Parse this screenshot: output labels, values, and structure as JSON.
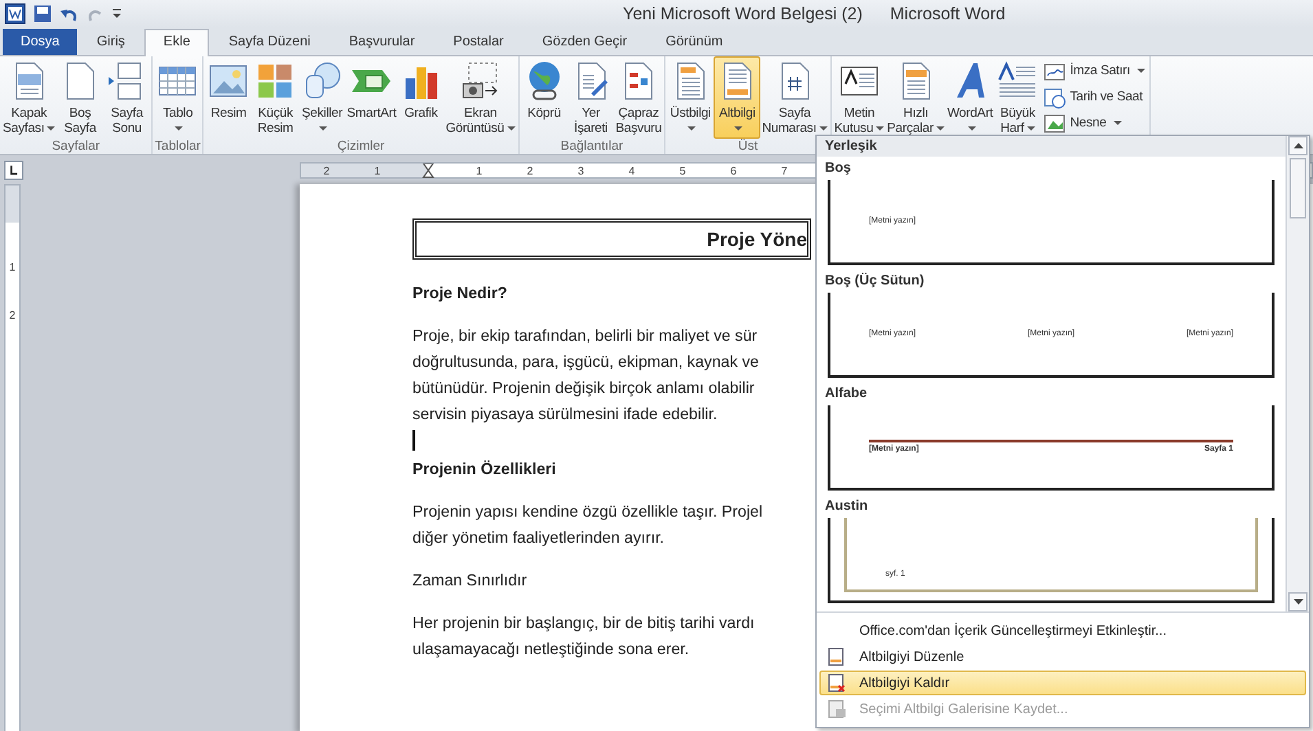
{
  "title_bar": {
    "document": "Yeni Microsoft Word Belgesi (2)",
    "app": "Microsoft Word"
  },
  "tabs": [
    {
      "label": "Dosya",
      "kind": "file",
      "selected": false
    },
    {
      "label": "Giriş",
      "kind": "tab",
      "selected": false
    },
    {
      "label": "Ekle",
      "kind": "tab",
      "selected": true
    },
    {
      "label": "Sayfa Düzeni",
      "kind": "tab",
      "selected": false
    },
    {
      "label": "Başvurular",
      "kind": "tab",
      "selected": false
    },
    {
      "label": "Postalar",
      "kind": "tab",
      "selected": false
    },
    {
      "label": "Gözden Geçir",
      "kind": "tab",
      "selected": false
    },
    {
      "label": "Görünüm",
      "kind": "tab",
      "selected": false
    }
  ],
  "ribbon": {
    "groups": [
      {
        "label": "Sayfalar",
        "buttons": [
          {
            "kind": "large",
            "lines": [
              "Kapak",
              "Sayfası"
            ],
            "dropdown": true,
            "selected": false
          },
          {
            "kind": "large",
            "lines": [
              "Boş",
              "Sayfa"
            ],
            "dropdown": false,
            "selected": false
          },
          {
            "kind": "large",
            "lines": [
              "Sayfa",
              "Sonu"
            ],
            "dropdown": false,
            "selected": false
          }
        ]
      },
      {
        "label": "Tablolar",
        "buttons": [
          {
            "kind": "large",
            "lines": [
              "Tablo"
            ],
            "dropdown": true,
            "selected": false
          }
        ]
      },
      {
        "label": "Çizimler",
        "buttons": [
          {
            "kind": "large",
            "lines": [
              "Resim"
            ],
            "dropdown": false,
            "selected": false
          },
          {
            "kind": "large",
            "lines": [
              "Küçük",
              "Resim"
            ],
            "dropdown": false,
            "selected": false
          },
          {
            "kind": "large",
            "lines": [
              "Şekiller"
            ],
            "dropdown": true,
            "selected": false
          },
          {
            "kind": "large",
            "lines": [
              "SmartArt"
            ],
            "dropdown": false,
            "selected": false
          },
          {
            "kind": "large",
            "lines": [
              "Grafik"
            ],
            "dropdown": false,
            "selected": false
          },
          {
            "kind": "large",
            "lines": [
              "Ekran",
              "Görüntüsü"
            ],
            "dropdown": true,
            "selected": false
          }
        ]
      },
      {
        "label": "Bağlantılar",
        "buttons": [
          {
            "kind": "large",
            "lines": [
              "Köprü"
            ],
            "dropdown": false,
            "selected": false
          },
          {
            "kind": "large",
            "lines": [
              "Yer",
              "İşareti"
            ],
            "dropdown": false,
            "selected": false
          },
          {
            "kind": "large",
            "lines": [
              "Çapraz",
              "Başvuru"
            ],
            "dropdown": false,
            "selected": false
          }
        ]
      },
      {
        "label": "Üst",
        "buttons": [
          {
            "kind": "large",
            "lines": [
              "Üstbilgi"
            ],
            "dropdown": true,
            "selected": false
          },
          {
            "kind": "large",
            "lines": [
              "Altbilgi"
            ],
            "dropdown": true,
            "selected": true
          },
          {
            "kind": "large",
            "lines": [
              "Sayfa",
              "Numarası"
            ],
            "dropdown": true,
            "selected": false
          }
        ]
      },
      {
        "buttons": [
          {
            "kind": "large",
            "lines": [
              "Metin",
              "Kutusu"
            ],
            "dropdown": true,
            "selected": false
          },
          {
            "kind": "large",
            "lines": [
              "Hızlı",
              "Parçalar"
            ],
            "dropdown": true,
            "selected": false
          },
          {
            "kind": "large",
            "lines": [
              "WordArt"
            ],
            "dropdown": true,
            "selected": false
          },
          {
            "kind": "large",
            "lines": [
              "Büyük",
              "Harf"
            ],
            "dropdown": true,
            "selected": false
          },
          {
            "kind": "small",
            "lines": [
              "İmza Satırı"
            ],
            "dropdown": true,
            "selected": false
          },
          {
            "kind": "small",
            "lines": [
              "Tarih ve Saat"
            ],
            "dropdown": false,
            "selected": false
          },
          {
            "kind": "small",
            "lines": [
              "Nesne"
            ],
            "dropdown": true,
            "selected": false
          }
        ]
      }
    ]
  },
  "rulers": {
    "horizontal": [
      {
        "kind": "number",
        "label": "2"
      },
      {
        "kind": "number",
        "label": "1"
      },
      {
        "kind": "indent"
      },
      {
        "kind": "number",
        "label": "1"
      },
      {
        "kind": "number",
        "label": "2"
      },
      {
        "kind": "number",
        "label": "3"
      },
      {
        "kind": "number",
        "label": "4"
      },
      {
        "kind": "number",
        "label": "5"
      },
      {
        "kind": "number",
        "label": "6"
      },
      {
        "kind": "number",
        "label": "7"
      }
    ],
    "vertical": [
      "1",
      "2"
    ]
  },
  "document": {
    "title": "Proje Yöne",
    "blocks": [
      {
        "kind": "heading",
        "lines": [
          "Proje Nedir?"
        ]
      },
      {
        "kind": "paragraph",
        "lines": [
          "Proje, bir ekip tarafından, belirli bir maliyet ve sür",
          "doğrultusunda,  para, işgücü, ekipman, kaynak ve",
          "bütünüdür.  Projenin değişik birçok anlamı olabilir",
          "servisin piyasaya sürülmesini ifade edebilir."
        ]
      },
      {
        "kind": "cursor"
      },
      {
        "kind": "heading",
        "lines": [
          "Projenin Özellikleri"
        ]
      },
      {
        "kind": "paragraph",
        "lines": [
          "Projenin yapısı kendine özgü özellikle taşır. Projel",
          "diğer yönetim faaliyetlerinden ayırır."
        ]
      },
      {
        "kind": "paragraph",
        "lines": [
          "Zaman Sınırlıdır"
        ]
      },
      {
        "kind": "paragraph",
        "lines": [
          "Her projenin bir başlangıç, bir de bitiş tarihi vardı",
          "ulaşamayacağı netleştiğinde sona erer."
        ]
      }
    ]
  },
  "footer_menu": {
    "section": "Yerleşik",
    "gallery": [
      {
        "name": "Boş",
        "kind": "blank",
        "texts": [
          "[Metni yazın]"
        ]
      },
      {
        "name": "Boş (Üç Sütun)",
        "kind": "three_column",
        "texts": [
          "[Metni yazın]",
          "[Metni yazın]",
          "[Metni yazın]"
        ]
      },
      {
        "name": "Alfabe",
        "kind": "alphabet",
        "texts": [
          "[Metni yazın]",
          "Sayfa 1"
        ]
      },
      {
        "name": "Austin",
        "kind": "austin",
        "texts": [
          "syf. 1"
        ]
      }
    ],
    "commands": [
      {
        "label": "Office.com'dan İçerik Güncelleştirmeyi Etkinleştir...",
        "selected": false,
        "disabled": false
      },
      {
        "label": "Altbilgiyi Düzenle",
        "selected": false,
        "disabled": false
      },
      {
        "label": "Altbilgiyi Kaldır",
        "selected": true,
        "disabled": false
      },
      {
        "label": "Seçimi Altbilgi Galerisine Kaydet...",
        "selected": false,
        "disabled": true
      }
    ]
  }
}
